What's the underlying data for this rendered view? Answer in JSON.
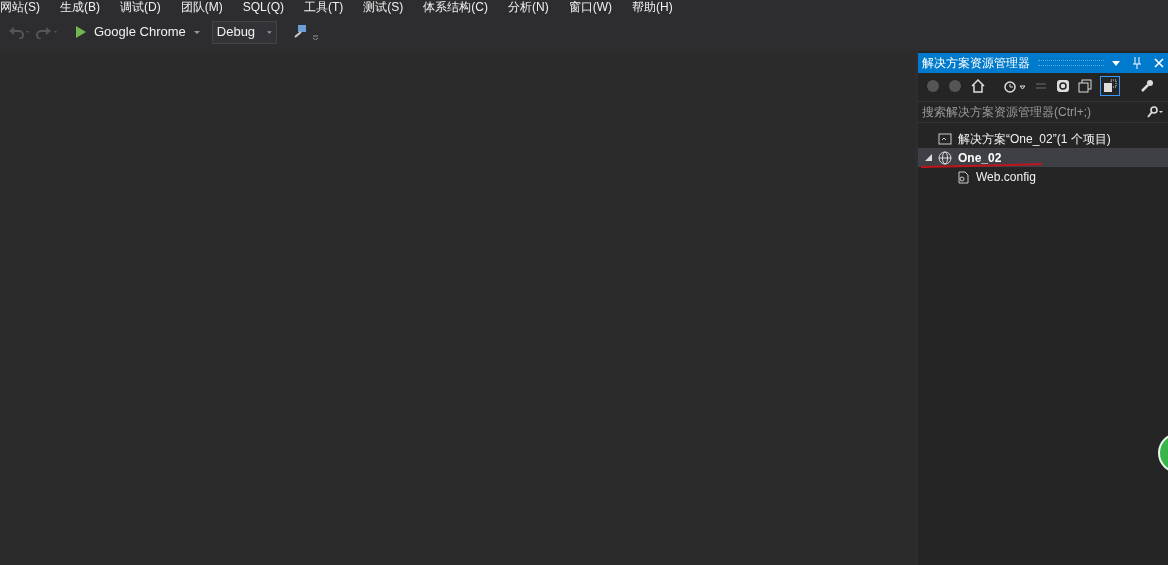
{
  "menu": [
    "网站(S)",
    "生成(B)",
    "调试(D)",
    "团队(M)",
    "SQL(Q)",
    "工具(T)",
    "测试(S)",
    "体系结构(C)",
    "分析(N)",
    "窗口(W)",
    "帮助(H)"
  ],
  "toolbar": {
    "browser": "Google Chrome",
    "configuration": "Debug"
  },
  "solution_explorer": {
    "title": "解决方案资源管理器",
    "search": {
      "placeholder": "搜索解决方案资源管理器(Ctrl+;)"
    },
    "tree": [
      {
        "kind": "solution",
        "label": "解决方案“One_02”(1 个项目)",
        "selected": false,
        "children": [
          {
            "kind": "project",
            "label": "One_02",
            "selected": true,
            "expanded": true,
            "children": [
              {
                "kind": "file",
                "label": "Web.config",
                "selected": false
              }
            ]
          }
        ]
      }
    ]
  }
}
